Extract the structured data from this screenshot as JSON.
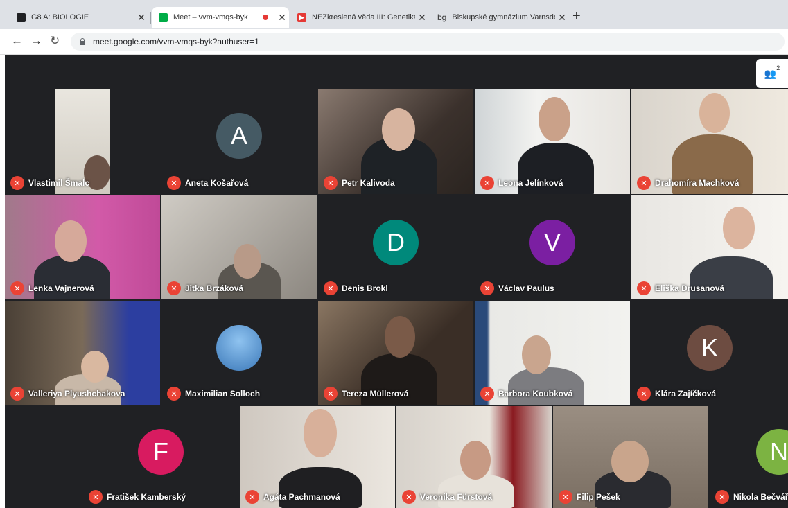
{
  "browser": {
    "tabs": [
      {
        "label": "G8 A: BIOLOGIE",
        "icon": "classroom-icon"
      },
      {
        "label": "Meet – vvm-vmqs-byk",
        "icon": "meet-icon",
        "active": true,
        "recording": true
      },
      {
        "label": "NEZkreslená věda III: Genetika - ",
        "icon": "youtube-icon"
      },
      {
        "label": "Biskupské gymnázium Varnsdorf",
        "icon": "school-icon",
        "fav_text": "bg"
      }
    ],
    "new_tab_label": "+",
    "url": "meet.google.com/vvm-vmqs-byk?authuser=1"
  },
  "meet": {
    "people_count": "2",
    "participants": [
      {
        "name": "Vlastimil Šmalc",
        "type": "video"
      },
      {
        "name": "Aneta Košařová",
        "type": "avatar",
        "initial": "A",
        "color": "#455a64"
      },
      {
        "name": "Petr Kalivoda",
        "type": "video"
      },
      {
        "name": "Leona Jelínková",
        "type": "video"
      },
      {
        "name": "Drahomíra Machková",
        "type": "video"
      },
      {
        "name": "Lenka Vajnerová",
        "type": "video"
      },
      {
        "name": "Jitka Brzáková",
        "type": "video"
      },
      {
        "name": "Denis Brokl",
        "type": "avatar",
        "initial": "D",
        "color": "#00897b"
      },
      {
        "name": "Václav Paulus",
        "type": "avatar",
        "initial": "V",
        "color": "#7b1fa2"
      },
      {
        "name": "Eliška Drusanová",
        "type": "video"
      },
      {
        "name": "Valleriya Plyushchakova",
        "type": "video"
      },
      {
        "name": "Maximilian Solloch",
        "type": "photo"
      },
      {
        "name": "Tereza Müllerová",
        "type": "video"
      },
      {
        "name": "Barbora Koubková",
        "type": "video"
      },
      {
        "name": "Klára Zajíčková",
        "type": "avatar",
        "initial": "K",
        "color": "#6d4c41"
      },
      {
        "name": "Fratišek Kamberský",
        "type": "avatar",
        "initial": "F",
        "color": "#d81b60"
      },
      {
        "name": "Agáta Pachmanová",
        "type": "video"
      },
      {
        "name": "Veronika Fürstová",
        "type": "video"
      },
      {
        "name": "Filip Pešek",
        "type": "video"
      },
      {
        "name": "Nikola Bečvářo",
        "type": "avatar",
        "initial": "N",
        "color": "#7cb342"
      }
    ]
  }
}
